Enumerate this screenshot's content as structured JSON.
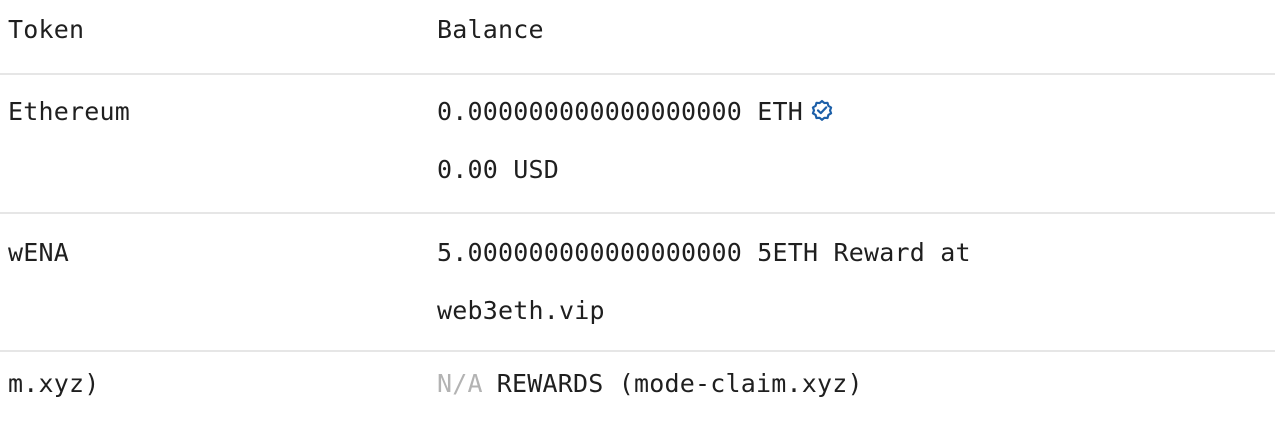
{
  "table": {
    "headers": {
      "token": "Token",
      "balance": "Balance"
    },
    "rows": [
      {
        "token": "Ethereum",
        "balance_line1": "0.000000000000000000 ETH",
        "balance_line2": "0.00 USD",
        "verified_icon": "verified-badge-icon",
        "verified_color": "#1c5fa8"
      },
      {
        "token": "wENA",
        "balance_line1": "5.000000000000000000 5ETH Reward at",
        "balance_line2": "web3eth.vip"
      },
      {
        "token": "m.xyz)",
        "balance_na": "N/A",
        "balance_rest": "REWARDS (mode-claim.xyz)"
      }
    ]
  }
}
